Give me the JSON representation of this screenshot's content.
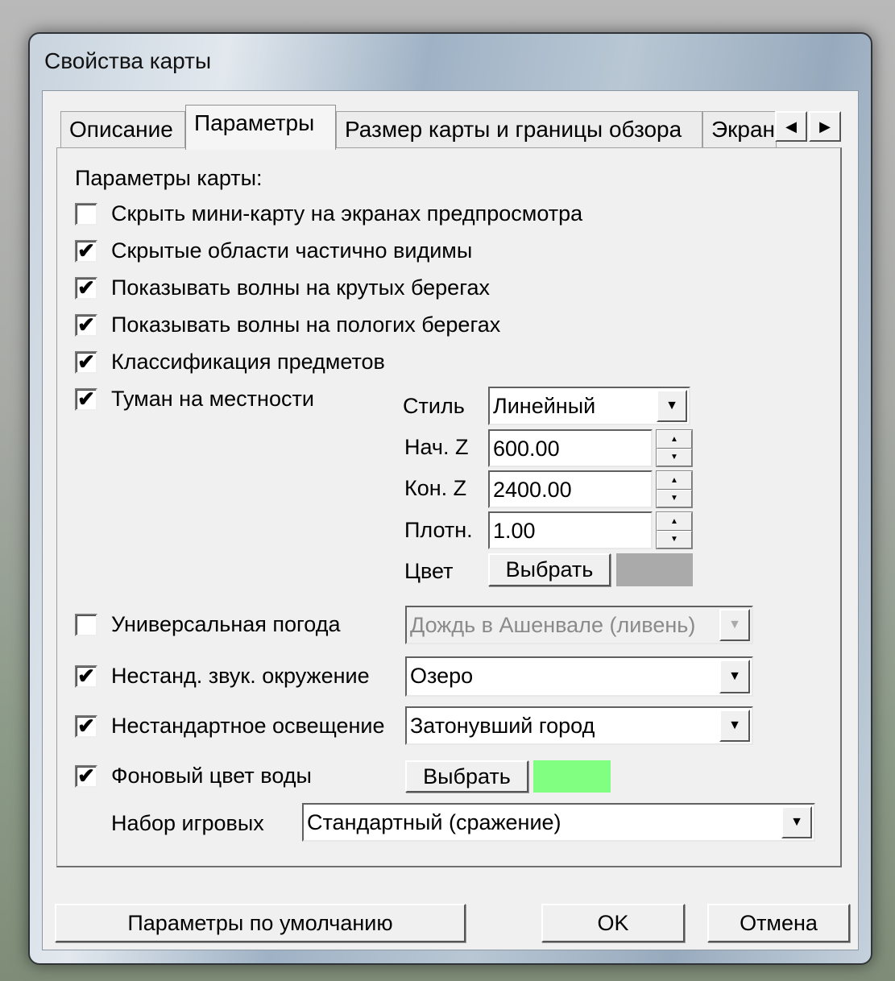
{
  "window": {
    "title": "Свойства карты"
  },
  "tabs": [
    "Описание",
    "Параметры",
    "Размер карты и границы обзора",
    "Экран"
  ],
  "tab_scroll": {
    "left": "◀",
    "right": "▶"
  },
  "section_label": "Параметры карты:",
  "checkboxes": [
    {
      "label": "Скрыть мини-карту на экранах предпросмотра",
      "checked": false,
      "mark": ""
    },
    {
      "label": "Скрытые области частично видимы",
      "checked": true,
      "mark": "✔"
    },
    {
      "label": "Показывать волны на крутых берегах",
      "checked": true,
      "mark": "✔"
    },
    {
      "label": "Показывать волны на пологих берегах",
      "checked": true,
      "mark": "✔"
    },
    {
      "label": "Классификация предметов",
      "checked": true,
      "mark": "✔"
    },
    {
      "label": "Туман на местности",
      "checked": true,
      "mark": "✔"
    }
  ],
  "fog": {
    "style_label": "Стиль",
    "style_value": "Линейный",
    "start_label": "Нач. Z",
    "start_value": "600.00",
    "end_label": "Кон. Z",
    "end_value": "2400.00",
    "density_label": "Плотн.",
    "density_value": "1.00",
    "color_label": "Цвет",
    "choose_label": "Выбрать",
    "color": "#aaaaaa"
  },
  "weather": {
    "label": "Универсальная погода",
    "checked": false,
    "mark": "",
    "value": "Дождь в Ашенвале (ливень)"
  },
  "sound": {
    "label": "Нестанд. звук. окружение",
    "checked": true,
    "mark": "✔",
    "value": "Озеро"
  },
  "lighting": {
    "label": "Нестандартное освещение",
    "checked": true,
    "mark": "✔",
    "value": "Затонувший город"
  },
  "water": {
    "label": "Фоновый цвет воды",
    "checked": true,
    "mark": "✔",
    "choose_label": "Выбрать",
    "color": "#80ff80"
  },
  "gameplay": {
    "label": "Набор игровых",
    "value": "Стандартный (сражение)"
  },
  "buttons": {
    "defaults": "Параметры по умолчанию",
    "ok": "OK",
    "cancel": "Отмена"
  }
}
